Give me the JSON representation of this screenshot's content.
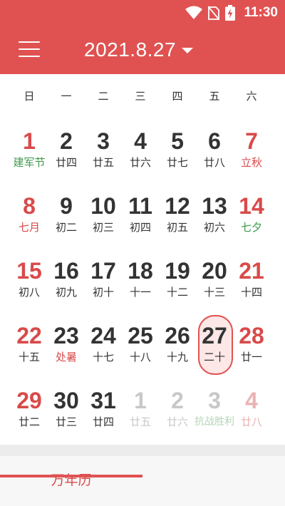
{
  "status_bar": {
    "time": "11:30",
    "icons": [
      "wifi-icon",
      "no-sim-icon",
      "battery-charging-icon"
    ]
  },
  "header": {
    "date_title": "2021.8.27"
  },
  "weekdays": [
    "日",
    "一",
    "二",
    "三",
    "四",
    "五",
    "六"
  ],
  "calendar": {
    "weeks": [
      [
        {
          "day": "1",
          "lunar": "建军节",
          "color": "red",
          "sub_color": "green",
          "muted": false
        },
        {
          "day": "2",
          "lunar": "廿四",
          "color": "default",
          "sub_color": "default",
          "muted": false
        },
        {
          "day": "3",
          "lunar": "廿五",
          "color": "default",
          "sub_color": "default",
          "muted": false
        },
        {
          "day": "4",
          "lunar": "廿六",
          "color": "default",
          "sub_color": "default",
          "muted": false
        },
        {
          "day": "5",
          "lunar": "廿七",
          "color": "default",
          "sub_color": "default",
          "muted": false
        },
        {
          "day": "6",
          "lunar": "廿八",
          "color": "default",
          "sub_color": "default",
          "muted": false
        },
        {
          "day": "7",
          "lunar": "立秋",
          "color": "red",
          "sub_color": "red",
          "muted": false
        }
      ],
      [
        {
          "day": "8",
          "lunar": "七月",
          "color": "red",
          "sub_color": "red",
          "muted": false
        },
        {
          "day": "9",
          "lunar": "初二",
          "color": "default",
          "sub_color": "default",
          "muted": false
        },
        {
          "day": "10",
          "lunar": "初三",
          "color": "default",
          "sub_color": "default",
          "muted": false
        },
        {
          "day": "11",
          "lunar": "初四",
          "color": "default",
          "sub_color": "default",
          "muted": false
        },
        {
          "day": "12",
          "lunar": "初五",
          "color": "default",
          "sub_color": "default",
          "muted": false
        },
        {
          "day": "13",
          "lunar": "初六",
          "color": "default",
          "sub_color": "default",
          "muted": false
        },
        {
          "day": "14",
          "lunar": "七夕",
          "color": "red",
          "sub_color": "green",
          "muted": false
        }
      ],
      [
        {
          "day": "15",
          "lunar": "初八",
          "color": "red",
          "sub_color": "default",
          "muted": false
        },
        {
          "day": "16",
          "lunar": "初九",
          "color": "default",
          "sub_color": "default",
          "muted": false
        },
        {
          "day": "17",
          "lunar": "初十",
          "color": "default",
          "sub_color": "default",
          "muted": false
        },
        {
          "day": "18",
          "lunar": "十一",
          "color": "default",
          "sub_color": "default",
          "muted": false
        },
        {
          "day": "19",
          "lunar": "十二",
          "color": "default",
          "sub_color": "default",
          "muted": false
        },
        {
          "day": "20",
          "lunar": "十三",
          "color": "default",
          "sub_color": "default",
          "muted": false
        },
        {
          "day": "21",
          "lunar": "十四",
          "color": "red",
          "sub_color": "default",
          "muted": false
        }
      ],
      [
        {
          "day": "22",
          "lunar": "十五",
          "color": "red",
          "sub_color": "default",
          "muted": false
        },
        {
          "day": "23",
          "lunar": "处暑",
          "color": "default",
          "sub_color": "red",
          "muted": false
        },
        {
          "day": "24",
          "lunar": "十七",
          "color": "default",
          "sub_color": "default",
          "muted": false
        },
        {
          "day": "25",
          "lunar": "十八",
          "color": "default",
          "sub_color": "default",
          "muted": false
        },
        {
          "day": "26",
          "lunar": "十九",
          "color": "default",
          "sub_color": "default",
          "muted": false
        },
        {
          "day": "27",
          "lunar": "二十",
          "color": "default",
          "sub_color": "default",
          "muted": false,
          "selected": true
        },
        {
          "day": "28",
          "lunar": "廿一",
          "color": "red",
          "sub_color": "default",
          "muted": false
        }
      ],
      [
        {
          "day": "29",
          "lunar": "廿二",
          "color": "red",
          "sub_color": "default",
          "muted": false
        },
        {
          "day": "30",
          "lunar": "廿三",
          "color": "default",
          "sub_color": "default",
          "muted": false
        },
        {
          "day": "31",
          "lunar": "廿四",
          "color": "default",
          "sub_color": "default",
          "muted": false
        },
        {
          "day": "1",
          "lunar": "廿五",
          "color": "default",
          "sub_color": "default",
          "muted": true
        },
        {
          "day": "2",
          "lunar": "廿六",
          "color": "default",
          "sub_color": "default",
          "muted": true
        },
        {
          "day": "3",
          "lunar": "抗战胜利",
          "color": "default",
          "sub_color": "green",
          "muted": true
        },
        {
          "day": "4",
          "lunar": "廿八",
          "color": "red",
          "sub_color": "default",
          "muted": true
        }
      ]
    ]
  },
  "tabs": {
    "lunar_calendar": "万年历"
  },
  "colors": {
    "brand_red": "#e05252",
    "holiday_green": "#3e9a4a",
    "muted_gray": "#c8c8c8",
    "selected_fill": "#fde7e7"
  }
}
